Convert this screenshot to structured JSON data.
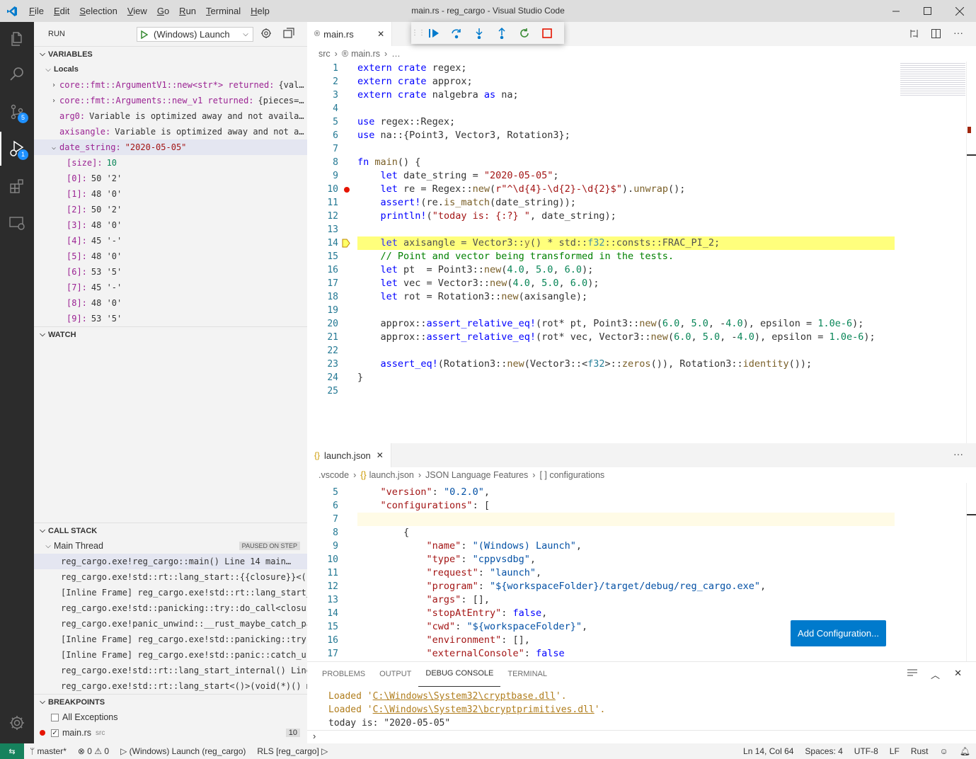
{
  "window": {
    "title": "main.rs - reg_cargo - Visual Studio Code"
  },
  "menu": [
    {
      "pre": "",
      "u": "F",
      "post": "ile"
    },
    {
      "pre": "",
      "u": "E",
      "post": "dit"
    },
    {
      "pre": "",
      "u": "S",
      "post": "election"
    },
    {
      "pre": "",
      "u": "V",
      "post": "iew"
    },
    {
      "pre": "",
      "u": "G",
      "post": "o"
    },
    {
      "pre": "",
      "u": "R",
      "post": "un"
    },
    {
      "pre": "",
      "u": "T",
      "post": "erminal"
    },
    {
      "pre": "",
      "u": "H",
      "post": "elp"
    }
  ],
  "activity": {
    "scm_badge": "5",
    "debug_badge": "1"
  },
  "run": {
    "label": "RUN",
    "config": "(Windows) Launch"
  },
  "variables": {
    "title": "VARIABLES",
    "locals": "Locals",
    "items": [
      {
        "name": "core::fmt::ArgumentV1::new<str*> returned:",
        "value": "{val…"
      },
      {
        "name": "core::fmt::Arguments::new_v1 returned:",
        "value": "{pieces=…"
      },
      {
        "name": "arg0:",
        "value": "Variable is optimized away and not availa…"
      },
      {
        "name": "axisangle:",
        "value": "Variable is optimized away and not a…"
      },
      {
        "name": "date_string:",
        "value": "\"2020-05-05\""
      }
    ],
    "children": [
      {
        "name": "[size]:",
        "value": "10"
      },
      {
        "name": "[0]:",
        "value": "50 '2'"
      },
      {
        "name": "[1]:",
        "value": "48 '0'"
      },
      {
        "name": "[2]:",
        "value": "50 '2'"
      },
      {
        "name": "[3]:",
        "value": "48 '0'"
      },
      {
        "name": "[4]:",
        "value": "45 '-'"
      },
      {
        "name": "[5]:",
        "value": "48 '0'"
      },
      {
        "name": "[6]:",
        "value": "53 '5'"
      },
      {
        "name": "[7]:",
        "value": "45 '-'"
      },
      {
        "name": "[8]:",
        "value": "48 '0'"
      },
      {
        "name": "[9]:",
        "value": "53 '5'"
      }
    ]
  },
  "watch": {
    "title": "WATCH"
  },
  "callstack": {
    "title": "CALL STACK",
    "thread": "Main Thread",
    "status": "PAUSED ON STEP",
    "frames": [
      "reg_cargo.exe!reg_cargo::main() Line 14  main…",
      "reg_cargo.exe!std::rt::lang_start::{{closure}}<()",
      "[Inline Frame] reg_cargo.exe!std::rt::lang_start_",
      "reg_cargo.exe!std::panicking::try::do_call<closur",
      "reg_cargo.exe!panic_unwind::__rust_maybe_catch_pa",
      "[Inline Frame] reg_cargo.exe!std::panicking::try(",
      "[Inline Frame] reg_cargo.exe!std::panic::catch_ur",
      "reg_cargo.exe!std::rt::lang_start_internal() Line",
      "reg_cargo.exe!std::rt::lang_start<()>(void(*)() m"
    ]
  },
  "breakpoints": {
    "title": "BREAKPOINTS",
    "all_exceptions": "All Exceptions",
    "file": "main.rs",
    "dir": "src",
    "line": "10"
  },
  "editor": {
    "tab": "main.rs",
    "breadcrumb": [
      "src",
      "main.rs",
      "…"
    ],
    "lines": [
      "1",
      "2",
      "3",
      "4",
      "5",
      "6",
      "7",
      "8",
      "9",
      "10",
      "11",
      "12",
      "13",
      "14",
      "15",
      "16",
      "17",
      "18",
      "19",
      "20",
      "21",
      "22",
      "23",
      "24",
      "25"
    ]
  },
  "lower_editor": {
    "tab": "launch.json",
    "breadcrumb": [
      ".vscode",
      "launch.json",
      "JSON Language Features",
      "[ ] configurations"
    ],
    "lines": [
      "5",
      "6",
      "7",
      "8",
      "9",
      "10",
      "11",
      "12",
      "13",
      "14",
      "15",
      "16",
      "17"
    ],
    "add_config": "Add Configuration..."
  },
  "panel": {
    "tabs": [
      "PROBLEMS",
      "OUTPUT",
      "DEBUG CONSOLE",
      "TERMINAL"
    ],
    "loaded1_pre": "Loaded '",
    "loaded1_path": "C:\\Windows\\System32\\cryptbase.dll",
    "loaded1_post": "'.",
    "loaded2_pre": "Loaded '",
    "loaded2_path": "C:\\Windows\\System32\\bcryptprimitives.dll",
    "loaded2_post": "'.",
    "output": "today is: \"2020-05-05\""
  },
  "status": {
    "branch": "master*",
    "errors": "0",
    "warnings": "0",
    "launch": "(Windows) Launch (reg_cargo)",
    "rls": "RLS [reg_cargo]",
    "position": "Ln 14, Col 64",
    "spaces": "Spaces: 4",
    "encoding": "UTF-8",
    "eol": "LF",
    "language": "Rust"
  }
}
